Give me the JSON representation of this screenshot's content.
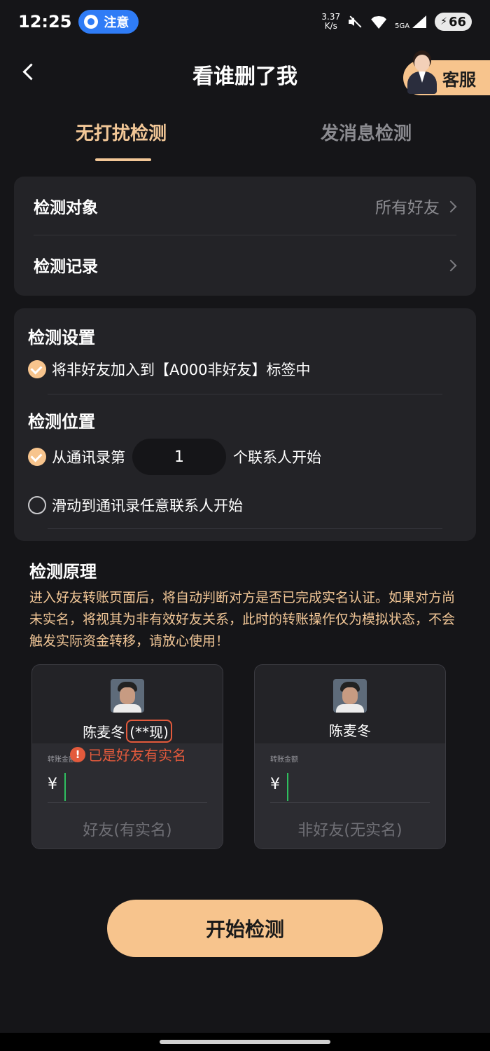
{
  "status_bar": {
    "time": "12:25",
    "badge_label": "注意",
    "net_speed_value": "3.37",
    "net_speed_unit": "K/s",
    "signal_label": "5GA",
    "wifi_label": "5",
    "battery": "66"
  },
  "header": {
    "title": "看谁删了我",
    "cs_label": "客服"
  },
  "tabs": [
    {
      "label": "无打扰检测",
      "active": true
    },
    {
      "label": "发消息检测",
      "active": false
    }
  ],
  "target_card": {
    "target_label": "检测对象",
    "target_value": "所有好友",
    "record_label": "检测记录"
  },
  "settings_card": {
    "settings_title": "检测设置",
    "option_tag": "将非好友加入到【A000非好友】标签中",
    "position_title": "检测位置",
    "option_from_prefix": "从通讯录第",
    "option_from_value": "1",
    "option_from_suffix": "个联系人开始",
    "option_scroll": "滑动到通讯录任意联系人开始"
  },
  "principle": {
    "title": "检测原理",
    "text": "进入好友转账页面后，将自动判断对方是否已完成实名认证。如果对方尚未实名，将视其为非有效好友关系，此时的转账操作仅为模拟状态，不会触发实际资金转移，请放心使用！"
  },
  "demo": {
    "left": {
      "name": "陈麦冬",
      "masked": "(**现)",
      "warning": "已是好友有实名",
      "amount_label": "转账金额",
      "currency": "¥",
      "caption": "好友(有实名)"
    },
    "right": {
      "name": "陈麦冬",
      "amount_label": "转账金额",
      "currency": "¥",
      "caption": "非好友(无实名)"
    }
  },
  "start_button": "开始检测",
  "colors": {
    "accent": "#f7c48d",
    "accent_text": "#f2c797",
    "warning": "#e35a3c",
    "background": "#151518",
    "card": "#232327"
  }
}
